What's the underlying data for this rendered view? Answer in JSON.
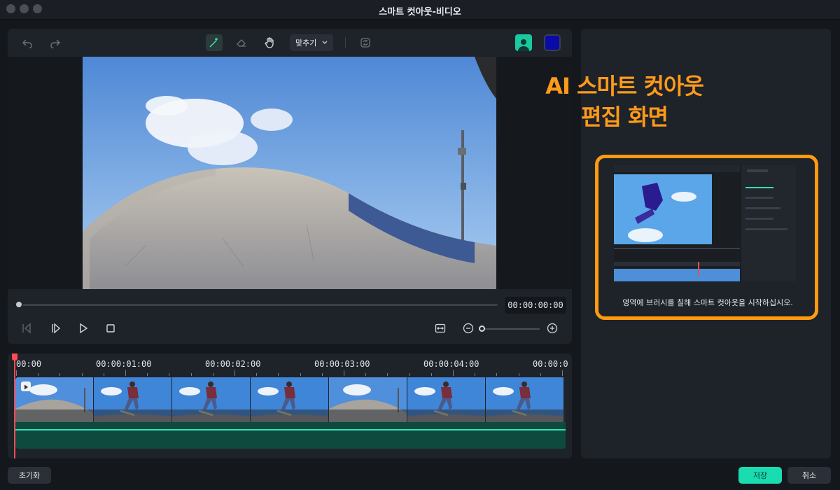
{
  "window": {
    "title": "스마트 컷아웃-비디오"
  },
  "toolbar": {
    "undo_icon": "undo-icon",
    "redo_icon": "redo-icon",
    "brush_icon": "smart-brush-icon",
    "eraser_icon": "eraser-icon",
    "hand_icon": "hand-icon",
    "fit_label": "맞추기",
    "reset_view_icon": "refresh-icon",
    "person_icon": "person-icon",
    "overlay_color": "#0a0aa8"
  },
  "player": {
    "timecode": "00:00:00:00",
    "progress": 0
  },
  "timeline": {
    "ruler_labels": [
      "00:00",
      "00:00:01:00",
      "00:00:02:00",
      "00:00:03:00",
      "00:00:04:00",
      "00:00:0"
    ]
  },
  "right_panel": {
    "annotation_line1": "AI 스마트 컷아웃",
    "annotation_line2": "편집 화면",
    "hint": "영역에 브러시를 칠해 스마트 컷아웃을 시작하십시오."
  },
  "footer": {
    "reset_label": "초기화",
    "save_label": "저장",
    "cancel_label": "취소"
  },
  "colors": {
    "accent": "#19dcb0",
    "annotation": "#ff9a1a",
    "playhead": "#ff4c55"
  }
}
